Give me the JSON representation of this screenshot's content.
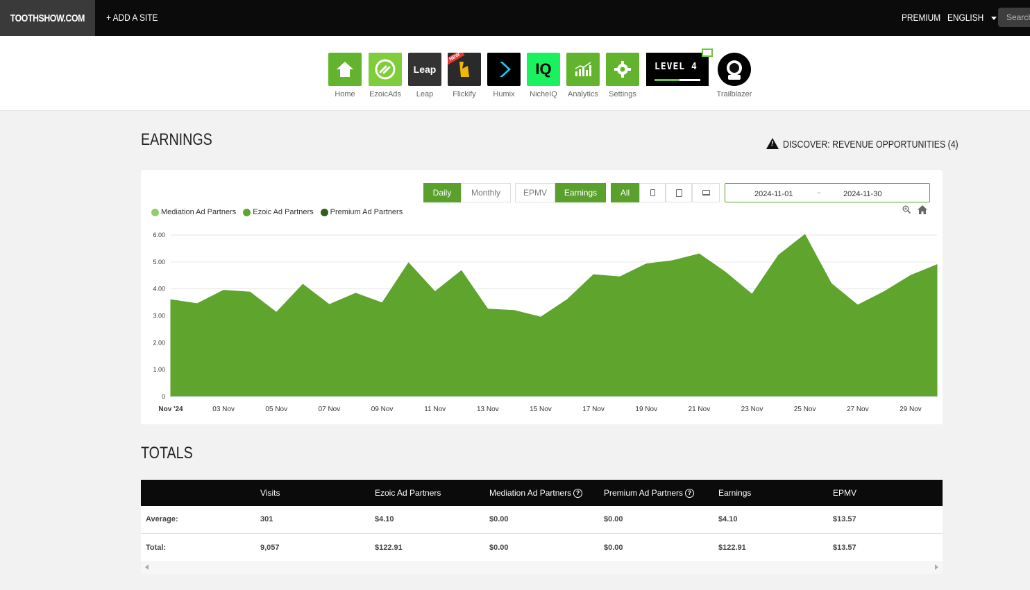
{
  "topbar": {
    "brand": "TOOTHSHOW.COM",
    "add_site": "+ ADD A SITE",
    "premium": "PREMIUM",
    "language": "ENGLISH",
    "search_placeholder": "Search"
  },
  "apps": [
    {
      "label": "Home",
      "icon": "home-icon"
    },
    {
      "label": "EzoicAds",
      "icon": "ezoicads-icon"
    },
    {
      "label": "Leap",
      "icon": "leap-icon",
      "tile_text": "Leap"
    },
    {
      "label": "Flickify",
      "icon": "flickify-icon",
      "badge": "NEW"
    },
    {
      "label": "Humix",
      "icon": "humix-icon"
    },
    {
      "label": "NicheIQ",
      "icon": "nicheiq-icon",
      "tile_text": "IQ"
    },
    {
      "label": "Analytics",
      "icon": "analytics-icon"
    },
    {
      "label": "Settings",
      "icon": "gear-icon"
    }
  ],
  "level": {
    "text": "LEVEL 4",
    "progress": 0.55
  },
  "trailblazer": {
    "label": "Trailblazer"
  },
  "earnings": {
    "title": "EARNINGS",
    "discover": "DISCOVER: REVENUE OPPORTUNITIES (4)",
    "buttons": {
      "daily": "Daily",
      "monthly": "Monthly",
      "epmv": "EPMV",
      "earnings": "Earnings",
      "all": "All"
    },
    "date_start": "2024-11-01",
    "date_sep": "~",
    "date_end": "2024-11-30"
  },
  "colors": {
    "mediation": "#93cc6f",
    "ezoic": "#5ea42d",
    "premium": "#2f5f19",
    "area": "#5ea42d"
  },
  "chart_data": {
    "type": "area",
    "series": [
      {
        "name": "Mediation Ad Partners",
        "values": [
          0,
          0,
          0,
          0,
          0,
          0,
          0,
          0,
          0,
          0,
          0,
          0,
          0,
          0,
          0,
          0,
          0,
          0,
          0,
          0,
          0,
          0,
          0,
          0,
          0,
          0,
          0,
          0,
          0,
          0
        ]
      },
      {
        "name": "Ezoic Ad Partners",
        "values": [
          3.6,
          3.45,
          3.95,
          3.88,
          3.13,
          4.17,
          3.42,
          3.84,
          3.48,
          4.97,
          3.9,
          4.68,
          3.25,
          3.2,
          2.95,
          3.6,
          4.53,
          4.45,
          4.93,
          5.05,
          5.3,
          4.62,
          3.8,
          5.25,
          6.02,
          4.2,
          3.4,
          3.9,
          4.5,
          4.9
        ]
      },
      {
        "name": "Premium Ad Partners",
        "values": [
          0,
          0,
          0,
          0,
          0,
          0,
          0,
          0,
          0,
          0,
          0,
          0,
          0,
          0,
          0,
          0,
          0,
          0,
          0,
          0,
          0,
          0,
          0,
          0,
          0,
          0,
          0,
          0,
          0,
          0
        ]
      }
    ],
    "x_tick_labels": [
      "Nov '24",
      "03 Nov",
      "05 Nov",
      "07 Nov",
      "09 Nov",
      "11 Nov",
      "13 Nov",
      "15 Nov",
      "17 Nov",
      "19 Nov",
      "21 Nov",
      "23 Nov",
      "25 Nov",
      "27 Nov",
      "29 Nov"
    ],
    "y_tick_labels": [
      "0",
      "1.00",
      "2.00",
      "3.00",
      "4.00",
      "5.00",
      "6.00"
    ],
    "ylim": [
      0,
      6
    ],
    "grid": true,
    "legend": "top-left"
  },
  "totals": {
    "title": "TOTALS",
    "headers": [
      "Visits",
      "Ezoic Ad Partners",
      "Mediation Ad Partners",
      "Premium Ad Partners",
      "Earnings",
      "EPMV"
    ],
    "rows": [
      {
        "label": "Average:",
        "values": [
          "301",
          "$4.10",
          "$0.00",
          "$0.00",
          "$4.10",
          "$13.57"
        ]
      },
      {
        "label": "Total:",
        "values": [
          "9,057",
          "$122.91",
          "$0.00",
          "$0.00",
          "$122.91",
          "$13.57"
        ]
      }
    ]
  }
}
